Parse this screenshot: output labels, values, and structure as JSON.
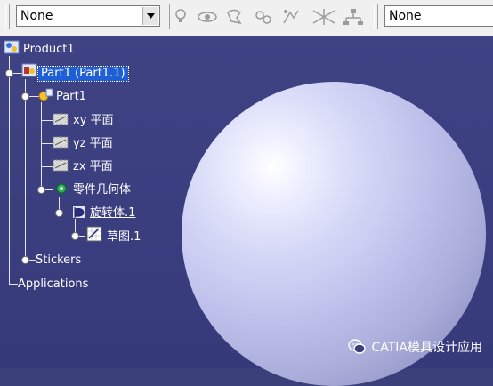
{
  "toolbar": {
    "left_combo_value": "None",
    "right_combo_value": "None",
    "icons": [
      "light-bulb-icon",
      "eye-icon",
      "material-icon",
      "bulb-link-icon",
      "analysis-icon",
      "network-icon",
      "tree-link-icon"
    ]
  },
  "tree": {
    "product": "Product1",
    "part_instance": "Part1 (Part1.1)",
    "part": "Part1",
    "xy_plane": "xy 平面",
    "yz_plane": "yz 平面",
    "zx_plane": "zx 平面",
    "main_body": "零件几何体",
    "revolve": "旋转体.1",
    "sketch": "草图.1",
    "stickers": "Stickers",
    "applications": "Applications"
  },
  "watermark": {
    "text": "CATIA模具设计应用"
  },
  "colors": {
    "background": "#3b3f7a",
    "selection": "#1f5fd6",
    "sphere": "#c4c6ee"
  }
}
